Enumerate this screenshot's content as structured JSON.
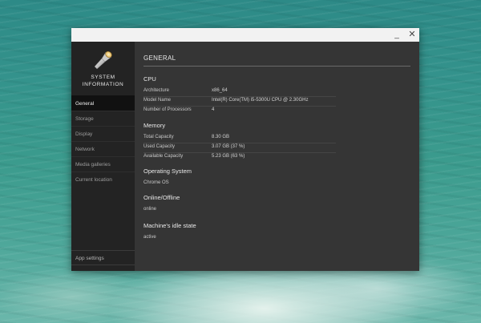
{
  "window": {
    "minimize_glyph": "_",
    "close_glyph": "✕"
  },
  "sidebar": {
    "logo_icon": "flashlight-icon",
    "logo_line1": "SYSTEM",
    "logo_line2": "INFORMATION",
    "items": [
      {
        "label": "General",
        "active": true
      },
      {
        "label": "Storage"
      },
      {
        "label": "Display"
      },
      {
        "label": "Network"
      },
      {
        "label": "Media galleries"
      },
      {
        "label": "Current location"
      }
    ],
    "settings_label": "App settings"
  },
  "main": {
    "title": "GENERAL",
    "cpu": {
      "heading": "CPU",
      "rows": [
        {
          "label": "Architecture",
          "value": "x86_64"
        },
        {
          "label": "Model Name",
          "value": "Intel(R) Core(TM) i5-5300U CPU @ 2.30GHz"
        },
        {
          "label": "Number of Processors",
          "value": "4"
        }
      ]
    },
    "memory": {
      "heading": "Memory",
      "rows": [
        {
          "label": "Total Capacity",
          "value": "8.30 GB"
        },
        {
          "label": "Used Capacity",
          "value": "3.07 GB (37 %)"
        },
        {
          "label": "Available Capacity",
          "value": "5.23 GB (63 %)"
        }
      ]
    },
    "os": {
      "heading": "Operating System",
      "value": "Chrome OS"
    },
    "online": {
      "heading": "Online/Offline",
      "value": "online"
    },
    "idle": {
      "heading": "Machine's idle state",
      "value": "active"
    }
  }
}
